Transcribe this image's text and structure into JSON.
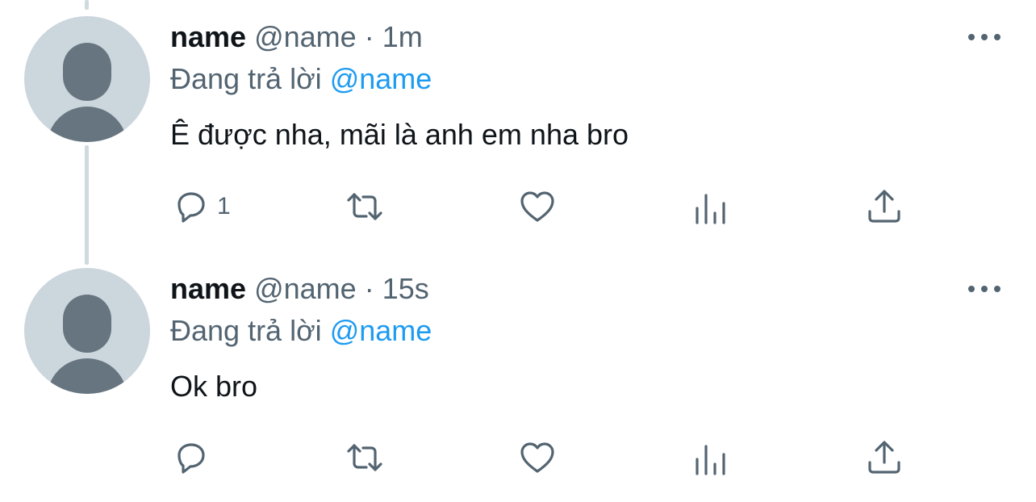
{
  "tweets": [
    {
      "display_name": "name",
      "handle": "@name",
      "separator": "·",
      "time": "1m",
      "reply_prefix": "Đang trả lời",
      "reply_mention": "@name",
      "text": "Ê được nha, mãi là anh em nha bro",
      "reply_count": "1",
      "icons": [
        "reply-icon",
        "retweet-icon",
        "like-icon",
        "analytics-icon",
        "share-icon",
        "more-icon"
      ]
    },
    {
      "display_name": "name",
      "handle": "@name",
      "separator": "·",
      "time": "15s",
      "reply_prefix": "Đang trả lời",
      "reply_mention": "@name",
      "text": "Ok bro",
      "reply_count": "",
      "icons": [
        "reply-icon",
        "retweet-icon",
        "like-icon",
        "analytics-icon",
        "share-icon",
        "more-icon"
      ]
    }
  ],
  "colors": {
    "text_primary": "#0f1419",
    "text_secondary": "#536471",
    "accent": "#1d9bf0",
    "avatar_bg": "#ccd6dd",
    "avatar_fg": "#66757f",
    "thread_line": "#cfd9de"
  }
}
